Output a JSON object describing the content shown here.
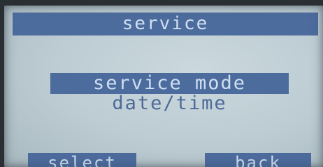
{
  "screen": {
    "title": "service",
    "menu": {
      "items": [
        {
          "label": "service mode",
          "selected": true
        },
        {
          "label": "date/time",
          "selected": false
        }
      ]
    },
    "softkeys": {
      "left_label": "select",
      "right_label": "back"
    }
  },
  "colors": {
    "lcd_background": "#bfcfd6",
    "highlight": "#4d6c9e",
    "text_on_highlight": "#cfdff0",
    "text": "#4e6a98"
  }
}
